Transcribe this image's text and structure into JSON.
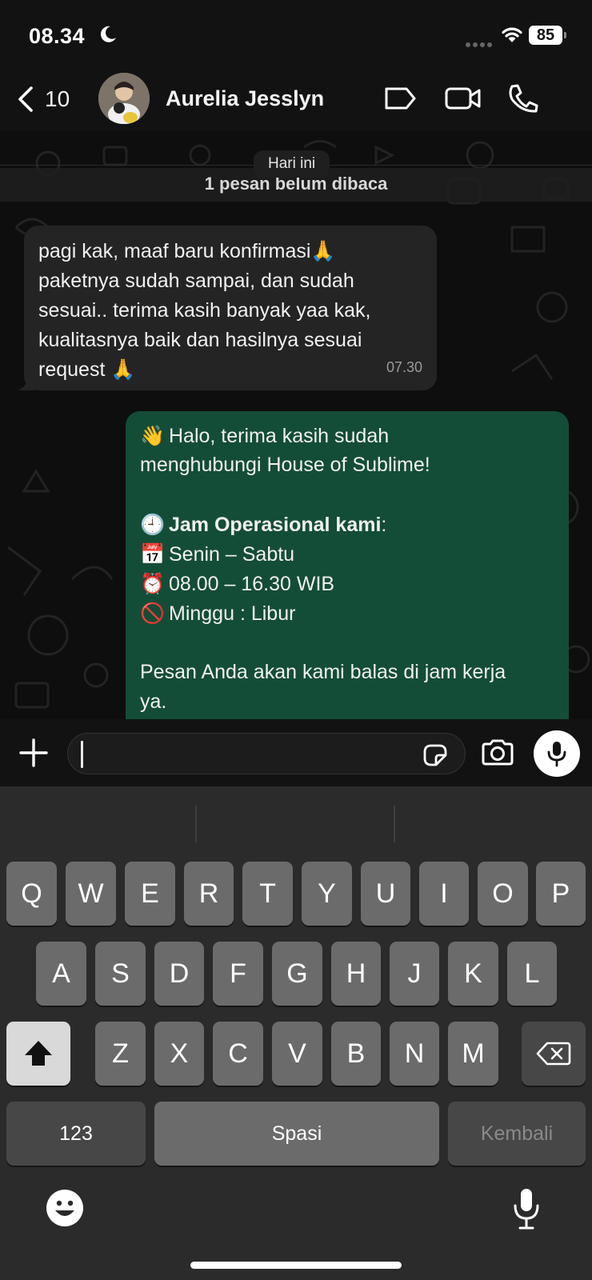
{
  "status_bar": {
    "time": "08.34",
    "battery": "85"
  },
  "header": {
    "back_count": "10",
    "contact_name": "Aurelia Jesslyn"
  },
  "chat": {
    "day_chip": "Hari ini",
    "unread_banner": "1 pesan belum dibaca",
    "incoming": {
      "lines": [
        "pagi kak, maaf baru konfirmasi🙏",
        "paketnya sudah sampai, dan sudah",
        "sesuai.. terima kasih banyak yaa kak,",
        "kualitasnya baik dan hasilnya sesuai",
        "request 🙏"
      ],
      "time": "07.30"
    },
    "outgoing": {
      "greeting_emoji": "👋",
      "greeting_line1": "Halo, terima kasih sudah",
      "greeting_line2": "menghubungi House of Sublime!",
      "hours_emoji": "🕘",
      "hours_title": "Jam Operasional kami",
      "hours_colon": ":",
      "days_emoji": "📅",
      "days": "Senin – Sabtu",
      "time_emoji": "⏰",
      "time_range": "08.00 – 16.30 WIB",
      "closed_emoji": "🚫",
      "closed": "Minggu : Libur",
      "footer_line1": "Pesan Anda akan kami balas di jam kerja",
      "footer_line2": "ya."
    }
  },
  "keyboard": {
    "row1": [
      "Q",
      "W",
      "E",
      "R",
      "T",
      "Y",
      "U",
      "I",
      "O",
      "P"
    ],
    "row2": [
      "A",
      "S",
      "D",
      "F",
      "G",
      "H",
      "J",
      "K",
      "L"
    ],
    "row3": [
      "Z",
      "X",
      "C",
      "V",
      "B",
      "N",
      "M"
    ],
    "numbers_label": "123",
    "space_label": "Spasi",
    "return_label": "Kembali"
  },
  "icons": {
    "back": "chevron-left-icon",
    "label": "label-tag-icon",
    "video": "video-call-icon",
    "phone": "phone-call-icon",
    "plus": "plus-icon",
    "sticker": "sticker-icon",
    "camera": "camera-icon",
    "mic": "microphone-icon",
    "shift": "shift-icon",
    "backspace": "backspace-icon",
    "emoji": "emoji-icon",
    "dictation": "dictation-mic-icon"
  },
  "colors": {
    "outgoing_bubble": "#144d37",
    "incoming_bubble": "#242424",
    "background": "#0e0e0e",
    "keyboard": "#2b2b2b"
  }
}
